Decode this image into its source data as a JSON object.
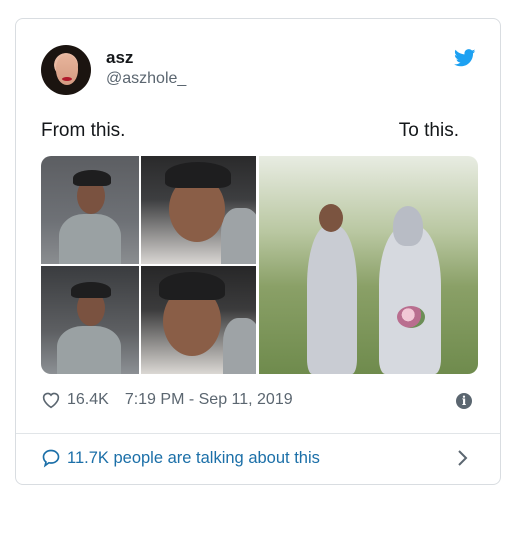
{
  "tweet": {
    "author_name": "asz",
    "author_handle": "@aszhole_",
    "text_left": "From this.",
    "text_right": "To this.",
    "likes": "16.4K",
    "timestamp": "7:19 PM - Sep 11, 2019",
    "talk_link": "11.7K people are talking about this",
    "brand_color": "#1DA1F2",
    "link_color": "#1b6fa8"
  },
  "icons": {
    "bird": "twitter-bird-icon",
    "heart": "heart-icon",
    "info": "info-icon",
    "bubble": "comment-bubble-icon",
    "chevron": "chevron-right-icon"
  }
}
